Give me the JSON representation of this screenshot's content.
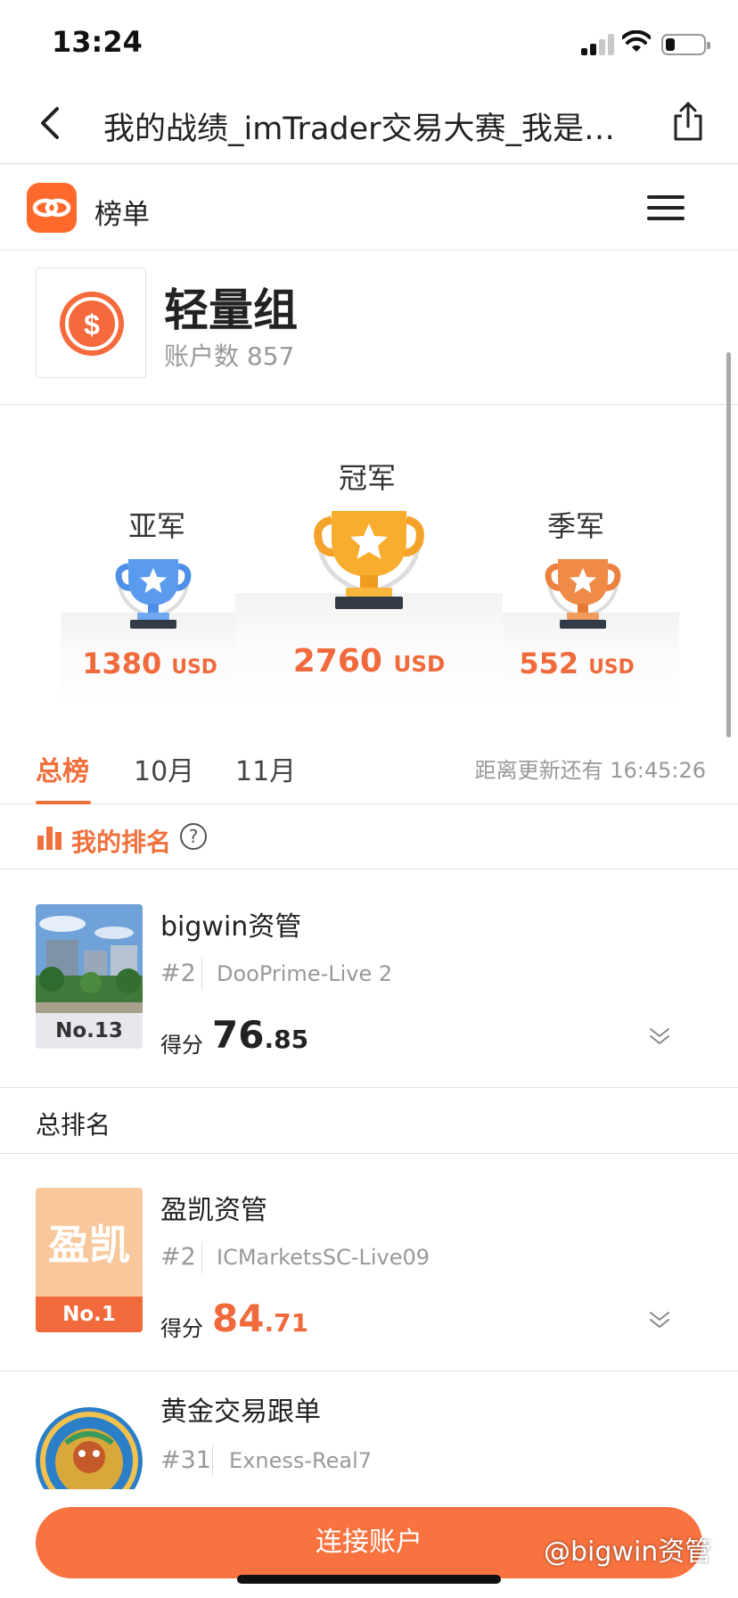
{
  "status": {
    "time": "13:24"
  },
  "nav": {
    "title": "我的战绩_imTrader交易大赛_我是…"
  },
  "app": {
    "section_label": "榜单"
  },
  "group": {
    "name": "轻量组",
    "account_label": "账户数",
    "account_count": "857"
  },
  "podium": {
    "first": {
      "label": "冠军",
      "amount": "2760",
      "unit": "USD"
    },
    "second": {
      "label": "亚军",
      "amount": "1380",
      "unit": "USD"
    },
    "third": {
      "label": "季军",
      "amount": "552",
      "unit": "USD"
    }
  },
  "tabs": [
    {
      "label": "总榜",
      "active": true
    },
    {
      "label": "10月",
      "active": false
    },
    {
      "label": "11月",
      "active": false
    }
  ],
  "countdown": "距离更新还有 16:45:26",
  "my_rank": {
    "label": "我的排名",
    "help": "?"
  },
  "my_card": {
    "name": "bigwin资管",
    "position": "#2",
    "server": "DooPrime-Live 2",
    "rank_badge": "No.13",
    "score_label": "得分",
    "score_int": "76",
    "score_dec": ".85"
  },
  "overall": {
    "label": "总排名"
  },
  "rows": [
    {
      "name": "盈凯资管",
      "position": "#2",
      "server": "ICMarketsSC-Live09",
      "avatar_text": "盈凯",
      "rank_badge": "No.1",
      "score_label": "得分",
      "score_int": "84",
      "score_dec": ".71"
    },
    {
      "name": "黄金交易跟单",
      "position": "#31",
      "server": "Exness-Real7"
    }
  ],
  "cta": {
    "label": "连接账户"
  },
  "watermark": "@bigwin资管",
  "colors": {
    "accent": "#f0703c",
    "button": "#f97340",
    "gold": "#f7a928",
    "silver": "#4e8fe8",
    "bronze": "#ef8a47"
  }
}
